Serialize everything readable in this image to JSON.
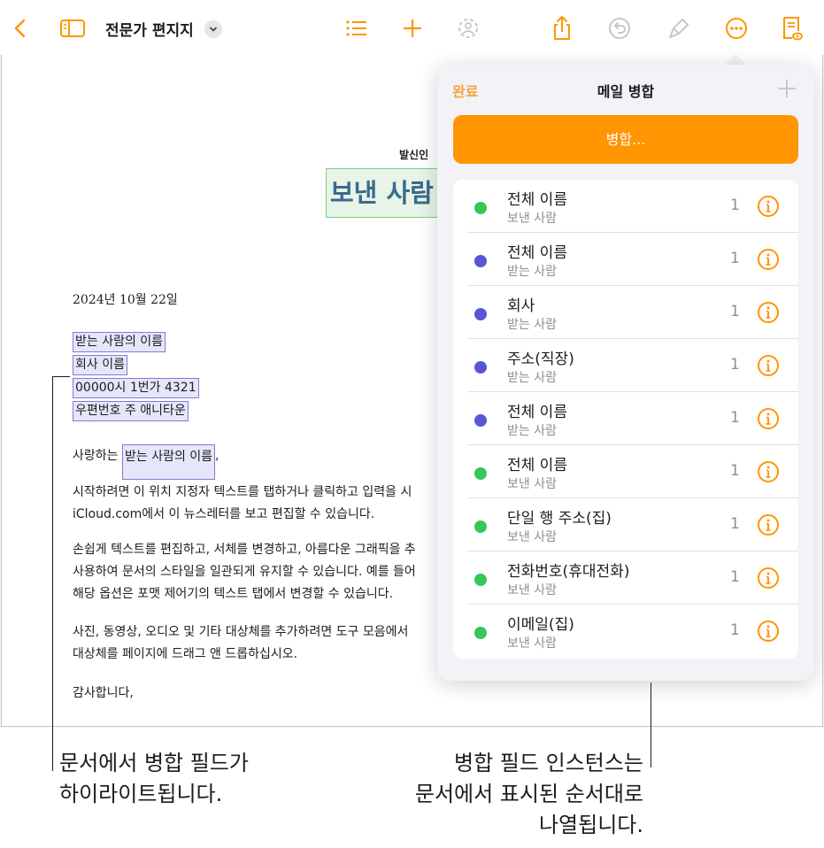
{
  "toolbar": {
    "document_title": "전문가 편지지",
    "icons": [
      "back-chevron-icon",
      "sidebar-icon",
      "title-menu-chevron-icon",
      "list-icon",
      "add-icon",
      "collaborate-icon",
      "share-icon",
      "undo-icon",
      "format-brush-icon",
      "more-icon",
      "reading-view-icon"
    ]
  },
  "document": {
    "sender_label": "발신인",
    "sender_name": "보낸 사람",
    "date": "2024년 10월 22일",
    "recipient_name": "받는 사람의 이름",
    "company": "회사 이름",
    "address_line": "00000시 1번가 4321",
    "postal_line": "우편번호 주 애니타운",
    "greeting_prefix": "사랑하는 ",
    "greeting_field": "받는 사람의 이름",
    "greeting_suffix": ",",
    "para1_line1": "시작하려면 이 위치 지정자 텍스트를 탭하거나 클릭하고 입력을 시",
    "para1_line2": "iCloud.com에서 이 뉴스레터를 보고 편집할 수 있습니다.",
    "para2_line1": "손쉽게 텍스트를 편집하고, 서체를 변경하고, 아름다운 그래픽을 추",
    "para2_line2": "사용하여 문서의 스타일을 일관되게 유지할 수 있습니다. 예를 들어",
    "para2_line3": "해당 옵션은 포맷 제어기의 텍스트 탭에서 변경할 수 있습니다.",
    "para3_line1": "사진, 동영상, 오디오 및 기타 대상체를 추가하려면 도구 모음에서",
    "para3_line2": "대상체를 페이지에 드래그 앤 드롭하십시오.",
    "closing": "감사합니다,"
  },
  "popover": {
    "done_label": "완료",
    "title": "메일 병합",
    "merge_button_label": "병합...",
    "fields": [
      {
        "name": "전체 이름",
        "source": "보낸 사람",
        "count": "1",
        "color": "#34c759"
      },
      {
        "name": "전체 이름",
        "source": "받는 사람",
        "count": "1",
        "color": "#5856d6"
      },
      {
        "name": "회사",
        "source": "받는 사람",
        "count": "1",
        "color": "#5856d6"
      },
      {
        "name": "주소(직장)",
        "source": "받는 사람",
        "count": "1",
        "color": "#5856d6"
      },
      {
        "name": "전체 이름",
        "source": "받는 사람",
        "count": "1",
        "color": "#5856d6"
      },
      {
        "name": "전체 이름",
        "source": "보낸 사람",
        "count": "1",
        "color": "#34c759"
      },
      {
        "name": "단일 행 주소(집)",
        "source": "보낸 사람",
        "count": "1",
        "color": "#34c759"
      },
      {
        "name": "전화번호(휴대전화)",
        "source": "보낸 사람",
        "count": "1",
        "color": "#34c759"
      },
      {
        "name": "이메일(집)",
        "source": "보낸 사람",
        "count": "1",
        "color": "#34c759"
      }
    ]
  },
  "callouts": {
    "left_line1": "문서에서 병합 필드가",
    "left_line2": "하이라이트됩니다.",
    "right_line1": "병합 필드 인스턴스는",
    "right_line2": "문서에서 표시된 순서대로",
    "right_line3": "나열됩니다."
  },
  "colors": {
    "accent": "#ff9500",
    "sender_field": "#34c759",
    "recipient_field": "#5856d6"
  }
}
